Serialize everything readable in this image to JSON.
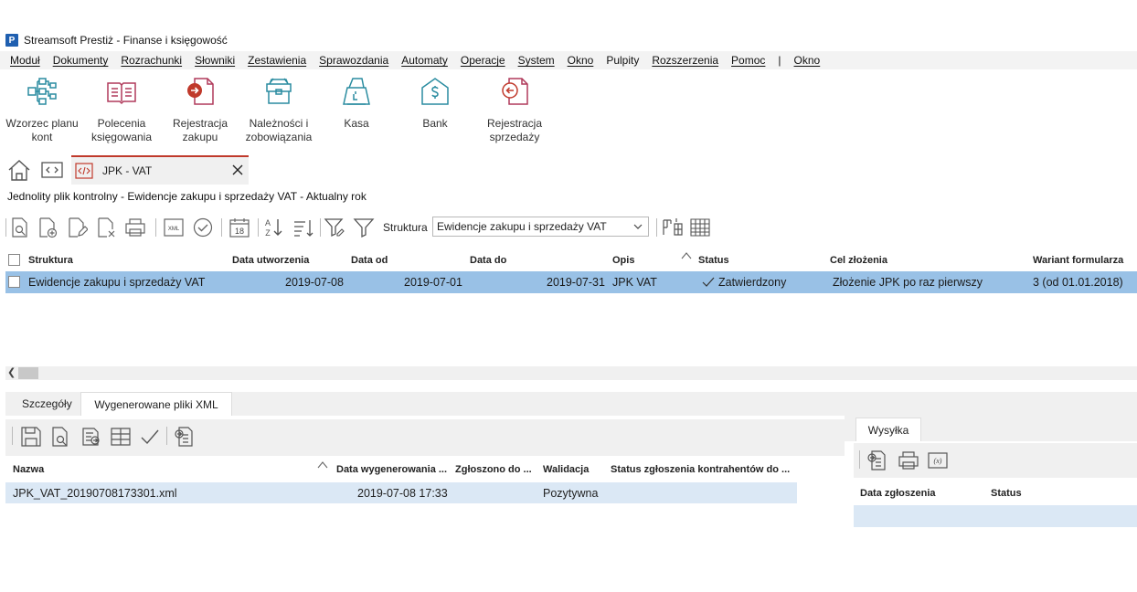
{
  "app": {
    "logo_letter": "P",
    "title": "Streamsoft Prestiż - Finanse i księgowość"
  },
  "menu": [
    "Moduł",
    "Dokumenty",
    "Rozrachunki",
    "Słowniki",
    "Zestawienia",
    "Sprawozdania",
    "Automaty",
    "Operacje",
    "System",
    "Okno",
    "Pulpity",
    "Rozszerzenia",
    "Pomoc",
    "|",
    "Okno"
  ],
  "ribbon": [
    {
      "line1": "Wzorzec planu",
      "line2": "kont",
      "icon": "account-tree-icon"
    },
    {
      "line1": "Polecenia",
      "line2": "księgowania",
      "icon": "ledger-book-icon"
    },
    {
      "line1": "Rejestracja",
      "line2": "zakupu",
      "icon": "purchase-doc-icon"
    },
    {
      "line1": "Należności i",
      "line2": "zobowiązania",
      "icon": "receivables-box-icon"
    },
    {
      "line1": "Kasa",
      "line2": "",
      "icon": "cash-register-icon"
    },
    {
      "line1": "Bank",
      "line2": "",
      "icon": "bank-icon"
    },
    {
      "line1": "Rejestracja",
      "line2": "sprzedaży",
      "icon": "sales-doc-icon"
    }
  ],
  "tabs": {
    "active_label": "JPK - VAT"
  },
  "page_header": "Jednolity plik kontrolny - Ewidencje zakupu i sprzedaży VAT - Aktualny rok",
  "toolbar": {
    "structure_label": "Struktura",
    "structure_value": "Ewidencje zakupu i sprzedaży VAT",
    "calendar_day": "18",
    "xml_label": "XML"
  },
  "grid": {
    "columns": [
      "Struktura",
      "Data utworzenia",
      "Data od",
      "Data do",
      "Opis",
      "Status",
      "Cel złożenia",
      "Wariant formularza"
    ],
    "row": {
      "struktura": "Ewidencje zakupu i sprzedaży VAT",
      "data_utworzenia": "2019-07-08",
      "data_od": "2019-07-01",
      "data_do": "2019-07-31",
      "opis": "JPK VAT",
      "status": "Zatwierdzony",
      "cel": "Złożenie JPK po raz pierwszy",
      "wariant": "3 (od 01.01.2018)"
    }
  },
  "lower_tabs": [
    "Szczegóły",
    "Wygenerowane pliki XML"
  ],
  "files": {
    "columns": [
      "Nazwa",
      "Data wygenerowania ...",
      "Zgłoszono do ...",
      "Walidacja",
      "Status zgłoszenia kontrahentów do ..."
    ],
    "row": {
      "nazwa": "JPK_VAT_20190708173301.xml",
      "data": "2019-07-08 17:33",
      "zgloszono": "",
      "walidacja": "Pozytywna",
      "status": ""
    }
  },
  "right_panel": {
    "tab": "Wysyłka",
    "columns": [
      "Data zgłoszenia",
      "Status"
    ],
    "fx_label": "(x)"
  },
  "colors": {
    "selection": "#99c1e6",
    "row_light": "#dbe8f5",
    "accent_red": "#c0392b",
    "icon_teal": "#2a8ca0"
  }
}
